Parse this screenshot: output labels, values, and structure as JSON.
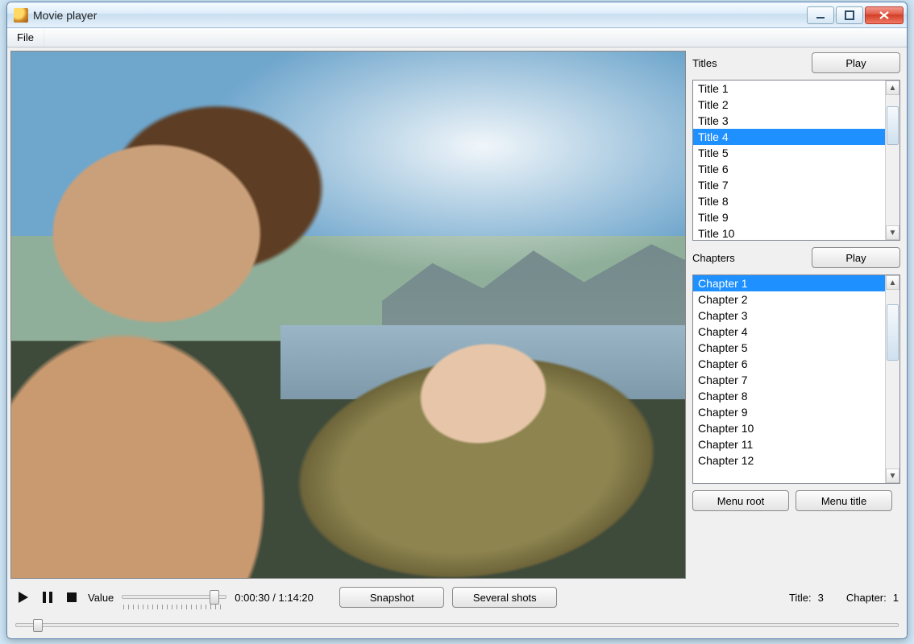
{
  "window": {
    "title": "Movie player"
  },
  "menubar": {
    "file": "File"
  },
  "side": {
    "titles_label": "Titles",
    "titles_play": "Play",
    "chapters_label": "Chapters",
    "chapters_play": "Play",
    "menu_root": "Menu root",
    "menu_title": "Menu title",
    "titles": [
      {
        "label": "Title 1",
        "selected": false
      },
      {
        "label": "Title 2",
        "selected": false
      },
      {
        "label": "Title 3",
        "selected": false
      },
      {
        "label": "Title 4",
        "selected": true
      },
      {
        "label": "Title 5",
        "selected": false
      },
      {
        "label": "Title 6",
        "selected": false
      },
      {
        "label": "Title 7",
        "selected": false
      },
      {
        "label": "Title 8",
        "selected": false
      },
      {
        "label": "Title 9",
        "selected": false
      },
      {
        "label": "Title 10",
        "selected": false
      }
    ],
    "chapters": [
      {
        "label": "Chapter 1",
        "selected": true
      },
      {
        "label": "Chapter 2",
        "selected": false
      },
      {
        "label": "Chapter 3",
        "selected": false
      },
      {
        "label": "Chapter 4",
        "selected": false
      },
      {
        "label": "Chapter 5",
        "selected": false
      },
      {
        "label": "Chapter 6",
        "selected": false
      },
      {
        "label": "Chapter 7",
        "selected": false
      },
      {
        "label": "Chapter 8",
        "selected": false
      },
      {
        "label": "Chapter 9",
        "selected": false
      },
      {
        "label": "Chapter 10",
        "selected": false
      },
      {
        "label": "Chapter 11",
        "selected": false
      },
      {
        "label": "Chapter 12",
        "selected": false
      }
    ]
  },
  "controls": {
    "value_label": "Value",
    "value_slider_pct": 92,
    "time_display": "0:00:30 / 1:14:20",
    "snapshot": "Snapshot",
    "several_shots": "Several shots",
    "status_title_label": "Title:",
    "status_title_value": "3",
    "status_chapter_label": "Chapter:",
    "status_chapter_value": "1",
    "seek_pct": 2.0
  }
}
